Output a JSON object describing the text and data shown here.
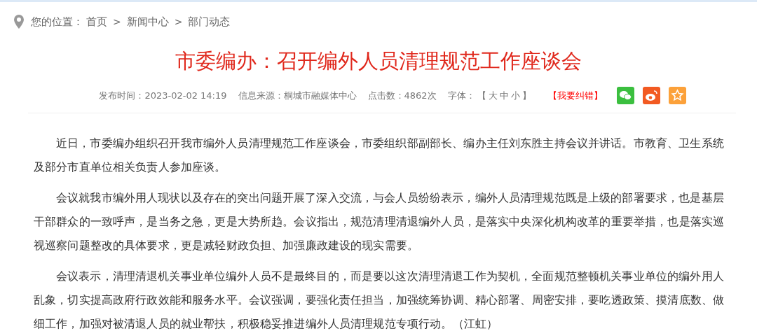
{
  "breadcrumb": {
    "label": "您的位置：",
    "items": [
      "首页",
      "新闻中心",
      "部门动态"
    ],
    "separator": ">"
  },
  "article": {
    "title": "市委编办：召开编外人员清理规范工作座谈会",
    "meta": {
      "published": "发布时间：2023-02-02 14:19",
      "source": "信息来源：桐城市融媒体中心",
      "clicks": "点击数：4862次",
      "font_label": "字体：",
      "font_open": "【",
      "font_sizes": [
        "大",
        "中",
        "小"
      ],
      "font_close": "】",
      "report": "【我要纠错】"
    },
    "paragraphs": [
      "近日，市委编办组织召开我市编外人员清理规范工作座谈会，市委组织部副部长、编办主任刘东胜主持会议并讲话。市教育、卫生系统及部分市直单位相关负责人参加座谈。",
      "会议就我市编外用人现状以及存在的突出问题开展了深入交流，与会人员纷纷表示，编外人员清理规范既是上级的部署要求，也是基层干部群众的一致呼声，是当务之急，更是大势所趋。会议指出，规范清理清退编外人员，是落实中央深化机构改革的重要举措，也是落实巡视巡察问题整改的具体要求，更是减轻财政负担、加强廉政建设的现实需要。",
      "会议表示，清理清退机关事业单位编外人员不是最终目的，而是要以这次清理清退工作为契机，全面规范整顿机关事业单位的编外用人乱象，切实提高政府行政效能和服务水平。会议强调，要强化责任担当，加强统筹协调、精心部署、周密安排，要吃透政策、摸清底数、做细工作，加强对被清退人员的就业帮扶，积极稳妥推进编外人员清理规范专项行动。（江虹）"
    ]
  }
}
